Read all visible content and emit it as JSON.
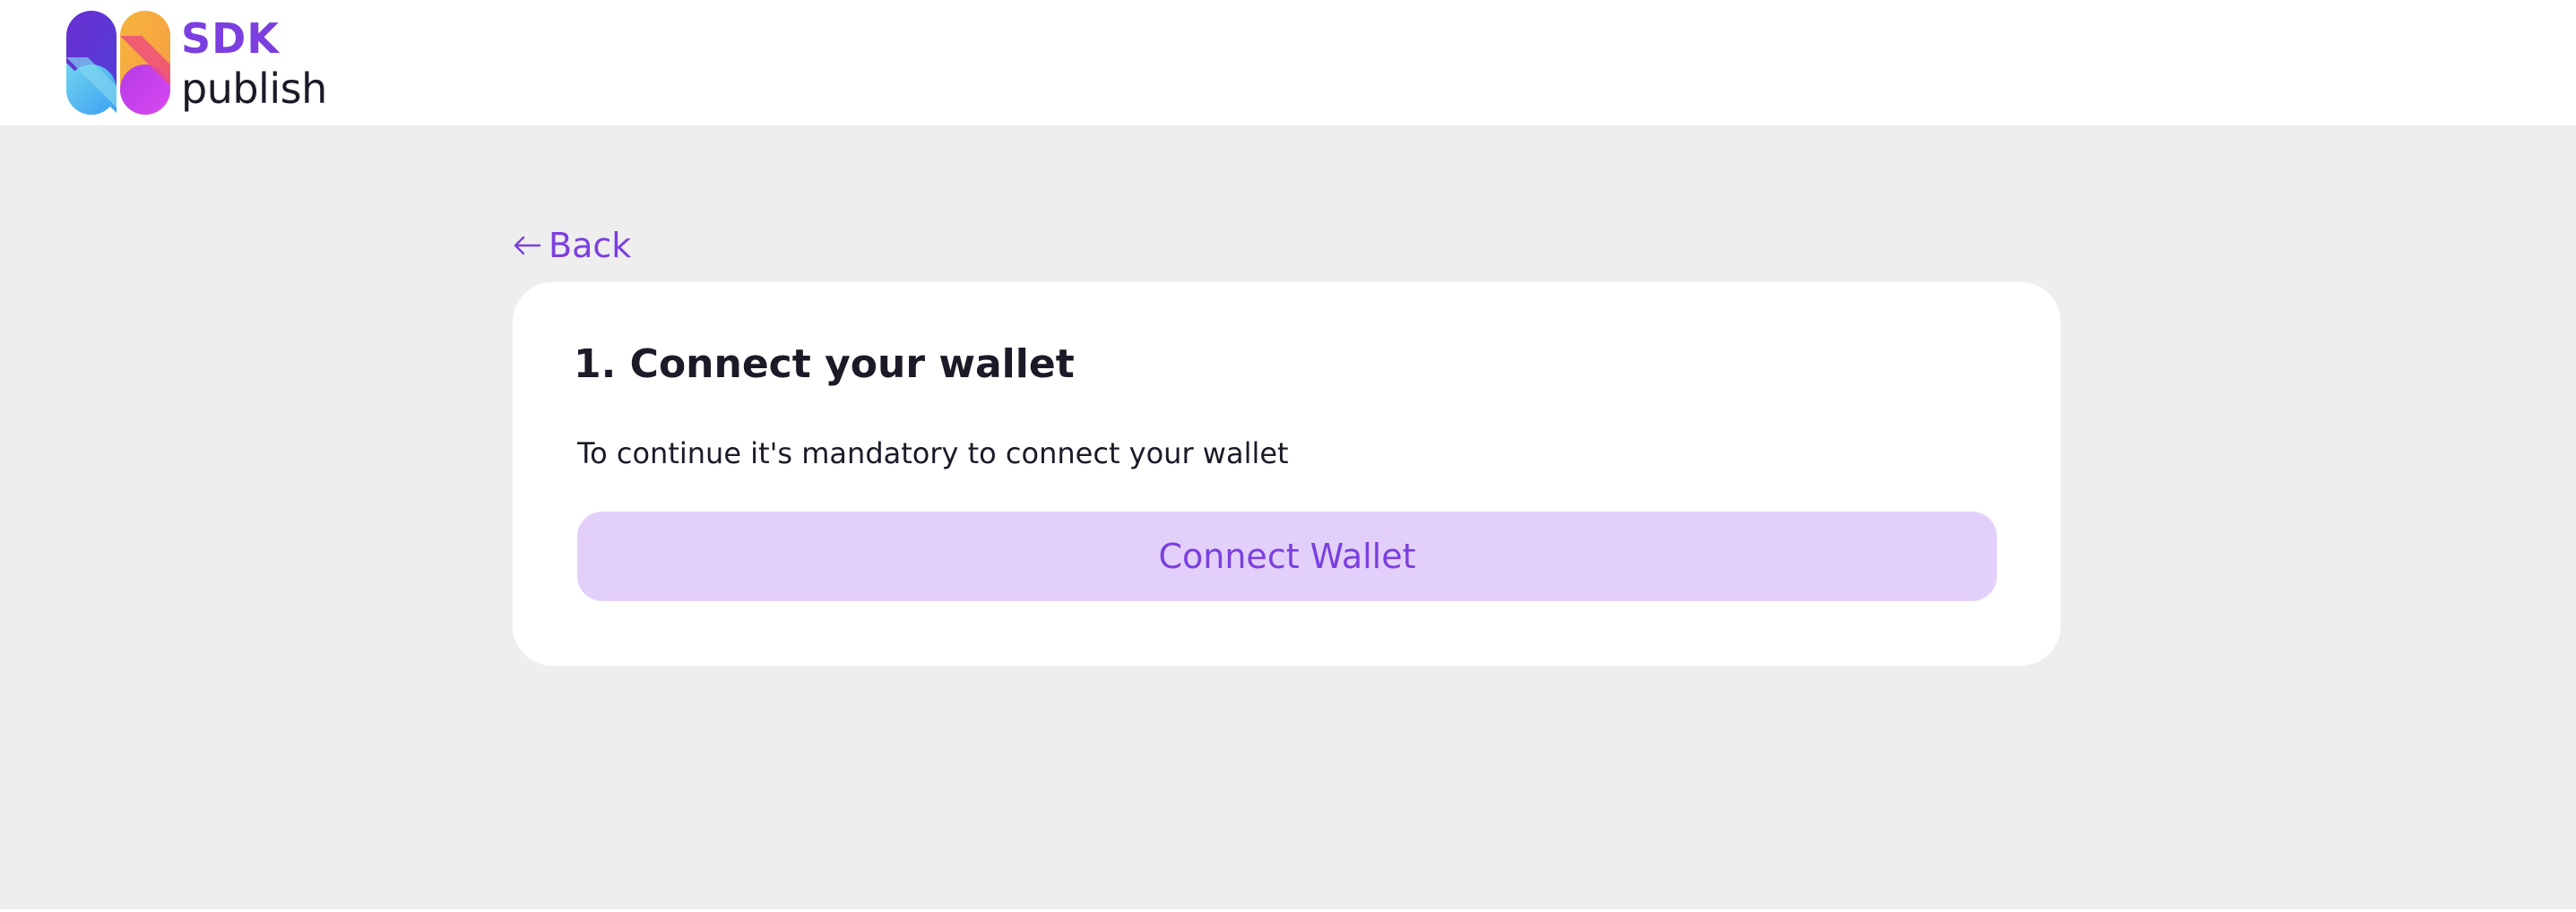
{
  "brand": {
    "name_top": "SDK",
    "name_bottom": "publish",
    "accent_color": "#7b3fe0",
    "logo_icon": "sdk-publish-logo-icon"
  },
  "navigation": {
    "back_label": "Back",
    "back_icon": "arrow-left-icon"
  },
  "step": {
    "title": "1. Connect your wallet",
    "description": "To continue it's mandatory to connect your wallet",
    "button_label": "Connect Wallet",
    "button_background": "#e3d0fa",
    "button_text_color": "#7b3fe0"
  },
  "colors": {
    "page_background": "#eeeeee",
    "card_background": "#ffffff",
    "text_primary": "#1b1b28"
  }
}
